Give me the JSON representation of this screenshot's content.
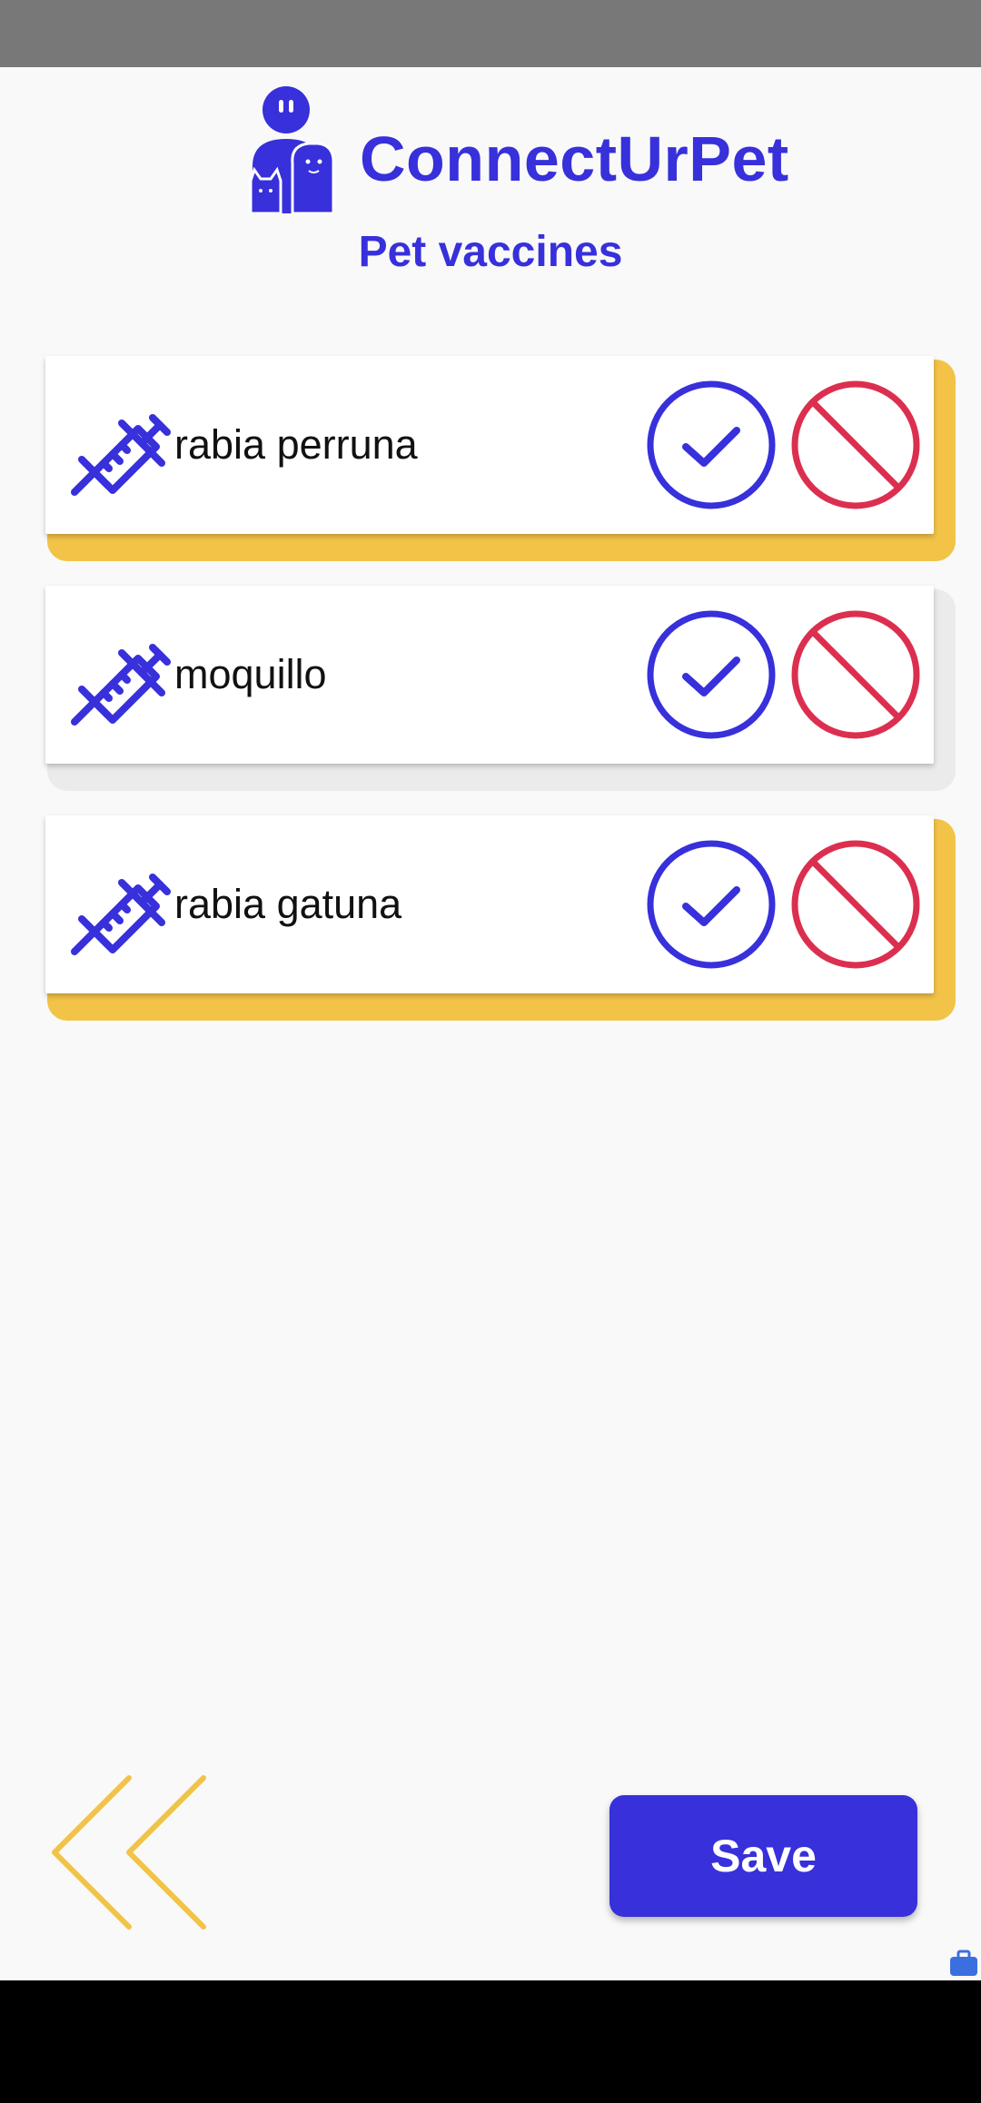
{
  "app": {
    "title": "ConnectUrPet",
    "page_title": "Pet vaccines"
  },
  "colors": {
    "primary": "#3730db",
    "accent": "#f2c347",
    "danger": "#dc2f4f"
  },
  "vaccines": [
    {
      "name": "rabia perruna",
      "highlight": "yellow"
    },
    {
      "name": "moquillo",
      "highlight": "gray"
    },
    {
      "name": "rabia gatuna",
      "highlight": "yellow"
    }
  ],
  "icons": {
    "logo": "user-with-pets-icon",
    "vaccine": "syringe-icon",
    "confirm": "check-circle-icon",
    "deny": "prohibited-icon",
    "back": "double-chevron-left-icon"
  },
  "footer": {
    "save_label": "Save"
  }
}
